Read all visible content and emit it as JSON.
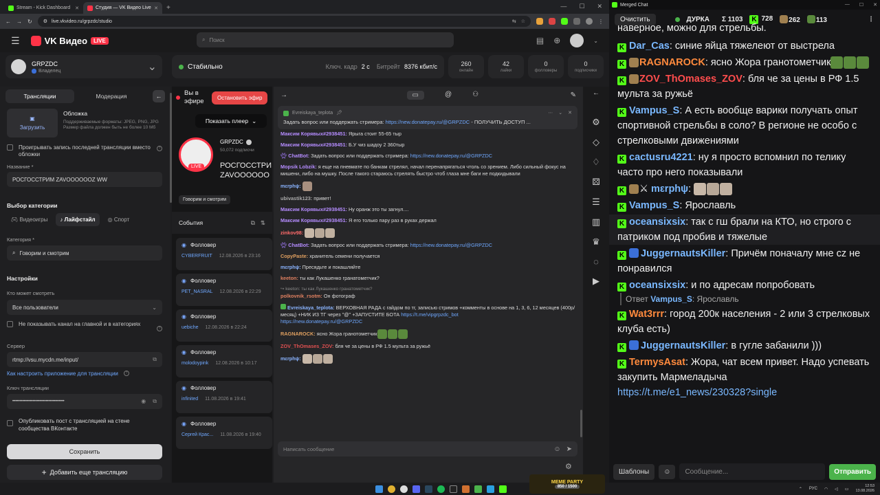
{
  "browser": {
    "tabs": [
      {
        "title": "Stream - Kick Dashboard",
        "favicon_color": "#53fc18"
      },
      {
        "title": "Студия — VK Видео Live",
        "favicon_color": "#ff3347"
      }
    ],
    "url": "live.vkvideo.ru/grpzdc/studio",
    "new_tab": "+"
  },
  "vk": {
    "logo_text": "VK Видео",
    "live_badge": "LIVE",
    "search_placeholder": "Поиск",
    "channel": {
      "name": "GRPZDC",
      "role": "Владелец"
    },
    "status": "Стабильно",
    "keyframe_label": "Ключ. кадр",
    "keyframe_value": "2 с",
    "bitrate_label": "Битрейт",
    "bitrate_value": "8376 кбит/с",
    "stats": [
      {
        "value": "260",
        "label": "онлайн"
      },
      {
        "value": "42",
        "label": "лайки"
      },
      {
        "value": "0",
        "label": "фолловеры"
      },
      {
        "value": "0",
        "label": "подписчики"
      }
    ]
  },
  "left": {
    "tab_streams": "Трансляции",
    "tab_moderation": "Модерация",
    "cover_title": "Обложка",
    "cover_desc": "Поддерживаемые форматы: JPEG, PNG, JPG Размер файла должен быть не более 10 Мб",
    "upload_label": "Загрузить",
    "replay_label": "Проигрывать запись последней трансляции вместо обложки",
    "name_label": "Название *",
    "name_value": "РОСГОССТРИМ ZAVOOOOOOZ WW",
    "category_section": "Выбор категории",
    "cat_games": "Видеоигры",
    "cat_life": "Лайфстайл",
    "cat_sport": "Спорт",
    "category_label": "Категория *",
    "category_value": "Говорим и смотрим",
    "settings_title": "Настройки",
    "who_can_watch_label": "Кто может смотреть",
    "who_can_watch_value": "Все пользователи",
    "hide_channel_label": "Не показывать канал на главной и в категориях",
    "server_label": "Сервер",
    "server_value": "rtmp://vsu.mycdn.me/input/",
    "setup_link": "Как настроить приложение для трансляции",
    "key_label": "Ключ трансляции",
    "key_value": "••••••••••••••••••••••••••••••••••••",
    "publish_label": "Опубликовать пост с трансляцией на стене сообщества ВКонтакте",
    "save_label": "Сохранить",
    "add_stream_label": "Добавить еще трансляцию"
  },
  "center": {
    "on_air": "Вы в эфире",
    "stop_label": "Остановить эфир",
    "show_player": "Показать плеер",
    "channel_name": "GRPZDC",
    "subs": "50,072 подписчи",
    "stream_title": "РОСГОССТРИ ZAVOOOOOOZ",
    "category_chip": "Говорим и смотрим",
    "events_title": "События",
    "events": [
      {
        "type": "Фолловер",
        "user": "CYBERFRUIT",
        "date": "12.08.2026 в 23:16"
      },
      {
        "type": "Фолловер",
        "user": "PET_NASRAL",
        "date": "12.08.2026 в 22:29"
      },
      {
        "type": "Фолловер",
        "user": "uebiche",
        "date": "12.08.2026 в 22:24"
      },
      {
        "type": "Фолловер",
        "user": "molodoypink",
        "date": "12.08.2026 в 10:17"
      },
      {
        "type": "Фолловер",
        "user": "infinited",
        "date": "11.08.2026 в 19:41"
      },
      {
        "type": "Фолловер",
        "user": "Сергей Крас...",
        "date": "11.08.2026 в 19:40"
      }
    ]
  },
  "chat": {
    "pinned_user": "Evreiskaya_teplota",
    "pinned_text": "Задать вопрос или поддержать стримера:",
    "pinned_link": "https://new.donatepay.ru/@GRPZDC",
    "pinned_tail": "- ПОЛУЧИТЬ ДОСТУП ...",
    "messages": [
      {
        "user": "Максим Корявых#2938451:",
        "color": "#b58cff",
        "text": "Ярыга стоит 55-65 тыр"
      },
      {
        "user": "Максим Корявых#2938451:",
        "color": "#b58cff",
        "text": "Б.У чиз шадоу 2 360тыр"
      },
      {
        "user": "ChatBot:",
        "color": "#b58cff",
        "text": "Задать вопрос или поддержать стримера:",
        "link": "https://new.donatepay.ru/@GRPZDC"
      },
      {
        "user": "Mopsik Lobzik:",
        "color": "#b58cff",
        "text": "я еще на пневмате по банкам стрелял, начал перенапрягаться чтоль со зрением. Либо сильный фокус на мишени, либо на мушку. После такого стараюсь стрелять быстро чтоб глаза мне баги не подкидывали"
      },
      {
        "user": "mεrphψ:",
        "color": "#8ab4ff",
        "text": ""
      },
      {
        "user": "ubivastik123:",
        "color": "#aaaaaa",
        "text": "привет!"
      },
      {
        "user": "Максим Корявых#2938451:",
        "color": "#b58cff",
        "text": "Ну оранж это ты загнул...."
      },
      {
        "user": "Максим Корявых#2938451:",
        "color": "#b58cff",
        "text": "Я его только пару раз в руках держал"
      },
      {
        "user": "zinkov98:",
        "color": "#ff6b6b",
        "text": ""
      },
      {
        "user": "ChatBot:",
        "color": "#b58cff",
        "text": "Задать вопрос или поддержать стримера:",
        "link": "https://new.donatepay.ru/@GRPZDC"
      },
      {
        "user": "CopyPaste:",
        "color": "#e0a060",
        "text": "хранитель семени получается"
      },
      {
        "user": "mεrphψ:",
        "color": "#8ab4ff",
        "text": "Пресядьте и покашляйте"
      },
      {
        "user": "keeton:",
        "color": "#e08060",
        "text": "ты как Лукашенко гранатометчик?"
      },
      {
        "user": "polkovnik_rsotm:",
        "color": "#e08060",
        "text": "Он фотограф",
        "reply": "keeton: ты как Лукашенко гранатометчик?"
      },
      {
        "user": "Evreiskaya_teplota:",
        "color": "#8ab4ff",
        "text": "ВЕРХОВНАЯ РАДА с гайдом по тг, записью стримов +комменты в основе на 1, 3, 6, 12 месяцев (400р/месяц) +НИК ИЗ ТГ через \"@\" +ЗАПУСТИТЕ БОТА",
        "link": "https://t.me/vipgrpzdc_bot",
        "link2": "https://new.donatepay.ru/@GRPZDC"
      },
      {
        "user": "RAGNAROCK:",
        "color": "#e0a060",
        "text": "ясно Жора гранотометчик"
      },
      {
        "user": "ZOV_ThOmases_ZOV:",
        "color": "#e05050",
        "text": "бля че за цены в РФ 1.5 мульта за ружьё"
      },
      {
        "user": "mεrphψ:",
        "color": "#8ab4ff",
        "text": ""
      }
    ],
    "input_placeholder": "Написать сообщение"
  },
  "merged": {
    "window_title": "Merged Chat",
    "clear_label": "Очистить",
    "streamer": "ДУРКА",
    "sum_label": "Σ 1103",
    "kick_count": "728",
    "vk_count": "262",
    "yt_count": "113",
    "top_fragment": "наверное, можно для стрельбы.",
    "messages": [
      {
        "user": "Dar_Cas",
        "color": "#9ad0ff",
        "text": ": синие яйца тяжелеют от выстрела",
        "badge": "kick"
      },
      {
        "user": "RAGNAROCK",
        "color": "#ff8a3d",
        "text": ": ясно Жора гранотометчик",
        "badge": "kick"
      },
      {
        "user": "ZOV_ThOmases_ZOV",
        "color": "#ff4d4d",
        "text": ": бля че за цены в РФ 1.5 мульта за ружьё",
        "badge": "kick"
      },
      {
        "user": "Vampus_S",
        "color": "#9ad0ff",
        "text": ": А есть вообще варики получать опыт спортивной стрельбы в соло? В регионе не особо с стрелковыми движениями",
        "badge": "kick"
      },
      {
        "user": "cactusru4221",
        "color": "#9ad0ff",
        "text": ": ну я просто вспомнил по телику часто про него показывали",
        "badge": "kick"
      },
      {
        "user": "mεrphψ",
        "color": "#9ad0ff",
        "text": ":",
        "badge": "kick"
      },
      {
        "user": "Vampus_S",
        "color": "#9ad0ff",
        "text": ": Ярославль",
        "badge": "kick"
      },
      {
        "user": "oceansixsix",
        "color": "#9ad0ff",
        "text": ": так с гш брали на КТО, но строго с патриком под пробив и тяжелые",
        "badge": "kick"
      },
      {
        "user": "JuggernautsKiller",
        "color": "#9ad0ff",
        "text": ": Причём поначалу мне cz не понравился",
        "badge": "kick"
      },
      {
        "user": "oceansixsix",
        "color": "#9ad0ff",
        "text": ": и по адресам попробовать",
        "badge": "kick",
        "reply_prefix": "Ответ",
        "reply_user": "Vampus_S",
        "reply_text": ": Ярославль"
      },
      {
        "user": "Wat3rrr",
        "color": "#ff8a3d",
        "text": ": город 200к населения - 2 или 3 стрелковых клуба есть)",
        "badge": "kick"
      },
      {
        "user": "JuggernautsKiller",
        "color": "#9ad0ff",
        "text": ": в гугле забанили )))",
        "badge": "kick"
      },
      {
        "user": "TermysAsat",
        "color": "#ff8a3d",
        "text": ": Жора, чат всем привет. Надо успевать закупить Мармеладыча",
        "badge": "kick",
        "link": "https://t.me/e1_news/230328?single"
      }
    ],
    "templates_label": "Шаблоны",
    "input_placeholder": "Сообщение...",
    "send_label": "Отправить"
  },
  "taskbar": {
    "widget_title": "MEME PARTY",
    "widget_value": "850 / 1500",
    "lang": "РУС",
    "time": "12:53",
    "date": "13.08.2026"
  }
}
